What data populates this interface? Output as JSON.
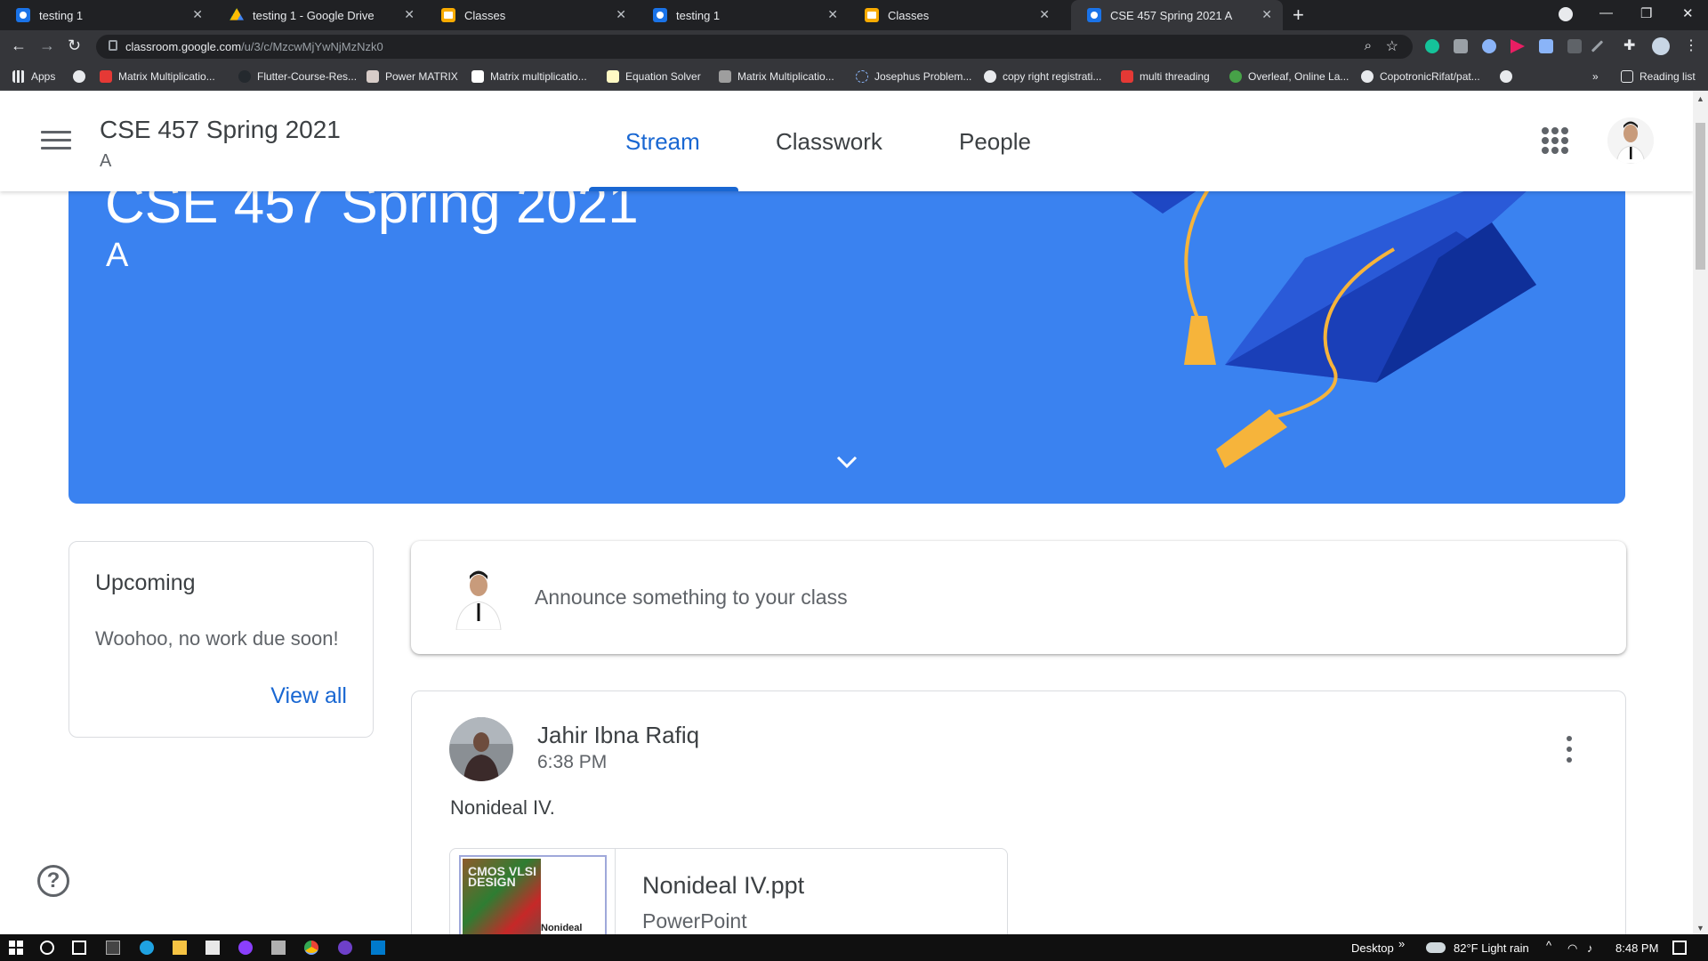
{
  "browser": {
    "tabs": [
      {
        "title": "testing 1",
        "icon": "classroom-icon"
      },
      {
        "title": "testing 1 - Google Drive",
        "icon": "drive-icon"
      },
      {
        "title": "Classes",
        "icon": "classes-icon"
      },
      {
        "title": "testing 1",
        "icon": "classroom-icon"
      },
      {
        "title": "Classes",
        "icon": "classes-icon"
      },
      {
        "title": "CSE 457 Spring 2021 A",
        "icon": "classroom-icon",
        "active": true
      }
    ],
    "url_host": "classroom.google.com",
    "url_path": "/u/3/c/MzcwMjYwNjMzNzk0",
    "bookmarks": [
      "Apps",
      "Matrix Multiplicatio...",
      "Flutter-Course-Res...",
      "Power MATRIX",
      "Matrix multiplicatio...",
      "Equation Solver",
      "Matrix Multiplicatio...",
      "Josephus Problem...",
      "copy right registrati...",
      "multi threading",
      "Overleaf, Online La...",
      "CopotronicRifat/pat..."
    ],
    "reading_list": "Reading list",
    "overflow": "»"
  },
  "classroom": {
    "title": "CSE 457 Spring 2021",
    "section": "A",
    "tabs": [
      "Stream",
      "Classwork",
      "People"
    ],
    "active_tab": "Stream"
  },
  "banner": {
    "title": "CSE 457 Spring 2021",
    "section": "A"
  },
  "upcoming": {
    "heading": "Upcoming",
    "empty_text": "Woohoo, no work due soon!",
    "view_all": "View all"
  },
  "announce": {
    "placeholder": "Announce something to your class"
  },
  "post": {
    "author": "Jahir Ibna Rafiq",
    "time": "6:38 PM",
    "body": "Nonideal IV.",
    "attachment": {
      "name": "Nonideal IV.ppt",
      "type": "PowerPoint",
      "thumb_cover_text": "CMOS VLSI DESIGN",
      "thumb_label": "Nonideal"
    }
  },
  "taskbar": {
    "desktop": "Desktop",
    "weather": "82°F  Light rain",
    "time": "8:48 PM"
  },
  "colors": {
    "accent": "#1967d2",
    "banner": "#3a82f0",
    "chrome_dark": "#202124"
  }
}
